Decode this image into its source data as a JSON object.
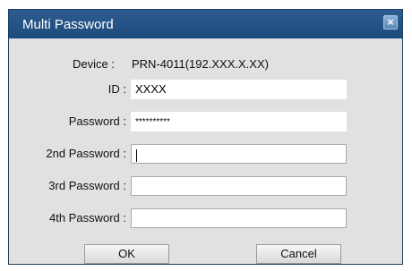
{
  "window": {
    "title": "Multi Password",
    "close_glyph": "×"
  },
  "device": {
    "label": "Device :",
    "value": "PRN-4011(192.XXX.X.XX)"
  },
  "id": {
    "label": "ID :",
    "value": "XXXX"
  },
  "password": {
    "label": "Password :",
    "value": "**********"
  },
  "password2": {
    "label": "2nd Password :",
    "value": ""
  },
  "password3": {
    "label": "3rd Password :",
    "value": ""
  },
  "password4": {
    "label": "4th Password :",
    "value": ""
  },
  "buttons": {
    "ok": "OK",
    "cancel": "Cancel"
  },
  "colors": {
    "titlebar": "#1e4b7c",
    "dialog_bg": "#e1e1e1"
  }
}
